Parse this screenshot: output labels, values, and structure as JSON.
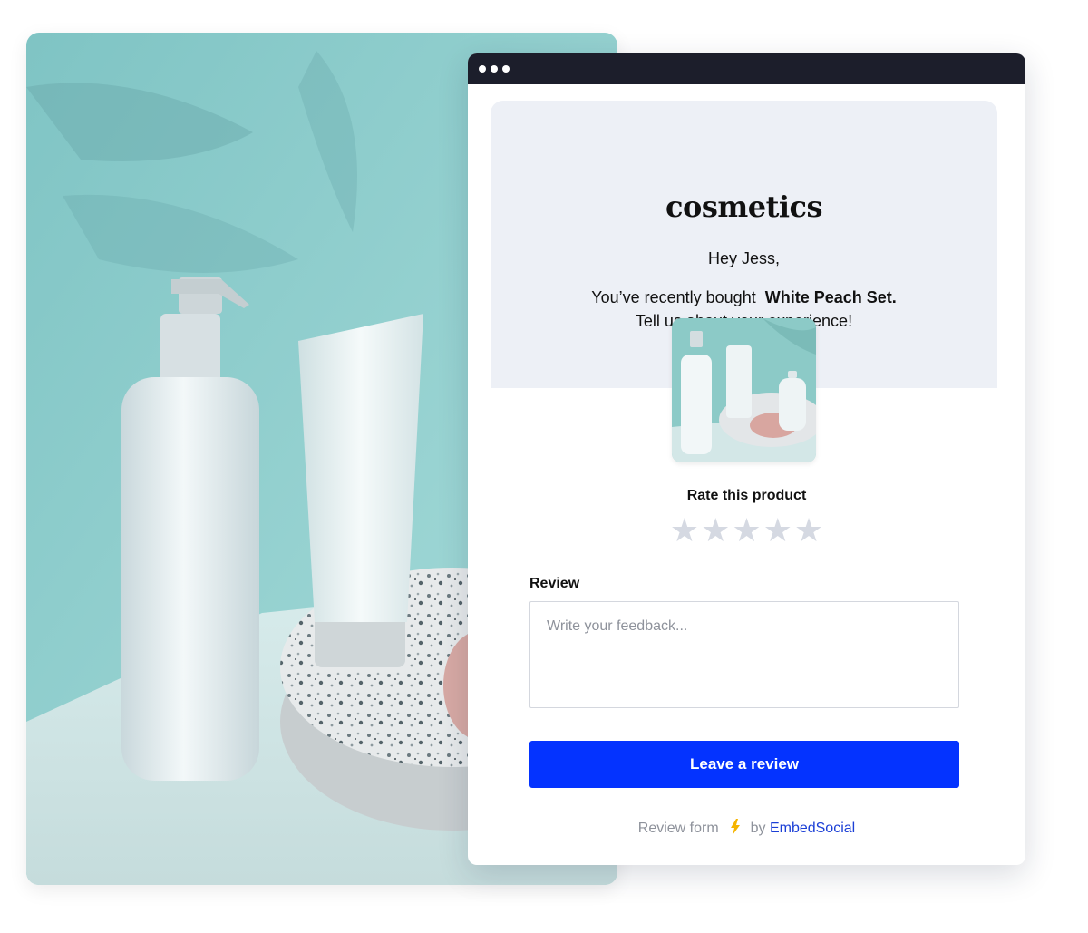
{
  "window": {
    "titlebar_dots": 3
  },
  "hero": {
    "brand": "cosmetics",
    "greeting": "Hey Jess,",
    "message_prefix": "You’ve recently bought  ",
    "product_name": "White Peach Set.",
    "message_line2": "Tell us about your experience!"
  },
  "rating": {
    "title": "Rate this product",
    "max_stars": 5,
    "selected": 0,
    "star_glyph": "★"
  },
  "review": {
    "label": "Review",
    "placeholder": "Write your feedback...",
    "value": ""
  },
  "submit": {
    "label": "Leave a review"
  },
  "footer": {
    "prefix": "Review form",
    "by": "by",
    "brand_link": "EmbedSocial",
    "icon": "lightning-bolt-icon"
  },
  "colors": {
    "accent": "#0433ff",
    "titlebar": "#1c1e2b",
    "hero_bg": "#edf0f6",
    "star_inactive": "#d5d9e2",
    "link": "#1b3fd6",
    "bolt": "#f5b400"
  }
}
